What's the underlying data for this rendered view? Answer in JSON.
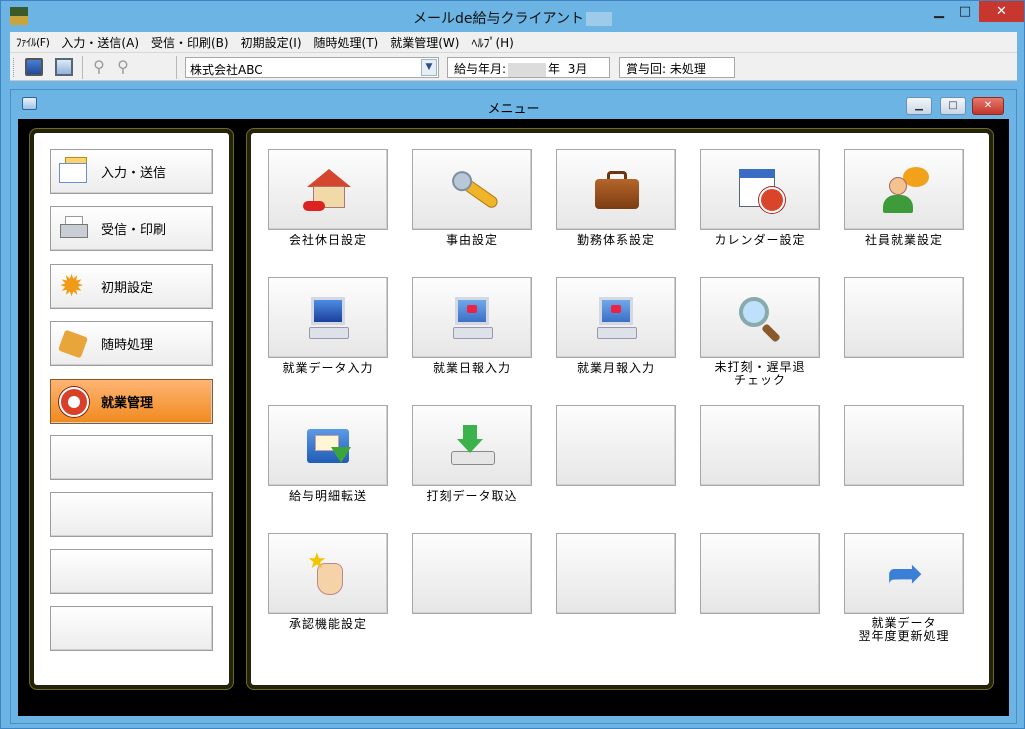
{
  "window": {
    "title": "メールde給与クライアント"
  },
  "menubar": [
    "ﾌｧｲﾙ(F)",
    "入力・送信(A)",
    "受信・印刷(B)",
    "初期設定(I)",
    "随時処理(T)",
    "就業管理(W)",
    "ﾍﾙﾌﾟ(H)"
  ],
  "toolbar": {
    "company": "株式会社ABC",
    "pay_month_label": "給与年月:",
    "pay_month_year_suffix": "年",
    "pay_month_month": "3月",
    "bonus": "賞与回: 未処理"
  },
  "child": {
    "title": "メニュー"
  },
  "nav": [
    {
      "label": "入力・送信",
      "icon": "envelope-icon",
      "active": false
    },
    {
      "label": "受信・印刷",
      "icon": "printer-icon",
      "active": false
    },
    {
      "label": "初期設定",
      "icon": "gear-icon",
      "active": false
    },
    {
      "label": "随時処理",
      "icon": "tools-icon",
      "active": false
    },
    {
      "label": "就業管理",
      "icon": "clock-icon",
      "active": true
    },
    {
      "label": "",
      "icon": "",
      "active": false
    },
    {
      "label": "",
      "icon": "",
      "active": false
    },
    {
      "label": "",
      "icon": "",
      "active": false
    },
    {
      "label": "",
      "icon": "",
      "active": false
    }
  ],
  "tiles": [
    {
      "label": "会社休日設定",
      "icon": "house-icon"
    },
    {
      "label": "事由設定",
      "icon": "wrench-icon"
    },
    {
      "label": "勤務体系設定",
      "icon": "briefcase-icon"
    },
    {
      "label": "カレンダー設定",
      "icon": "calendar-clock-icon"
    },
    {
      "label": "社員就業設定",
      "icon": "person-chat-icon"
    },
    {
      "label": "就業データ入力",
      "icon": "computer-icon"
    },
    {
      "label": "就業日報入力",
      "icon": "computer-chart-icon"
    },
    {
      "label": "就業月報入力",
      "icon": "computer-chart-icon"
    },
    {
      "label": "未打刻・遅早退\nチェック",
      "icon": "magnifier-icon"
    },
    {
      "label": "",
      "icon": ""
    },
    {
      "label": "給与明細転送",
      "icon": "folder-transfer-icon"
    },
    {
      "label": "打刻データ取込",
      "icon": "download-icon"
    },
    {
      "label": "",
      "icon": ""
    },
    {
      "label": "",
      "icon": ""
    },
    {
      "label": "",
      "icon": ""
    },
    {
      "label": "承認機能設定",
      "icon": "hand-star-icon"
    },
    {
      "label": "",
      "icon": ""
    },
    {
      "label": "",
      "icon": ""
    },
    {
      "label": "",
      "icon": ""
    },
    {
      "label": "就業データ\n翌年度更新処理",
      "icon": "curved-arrow-icon"
    }
  ]
}
